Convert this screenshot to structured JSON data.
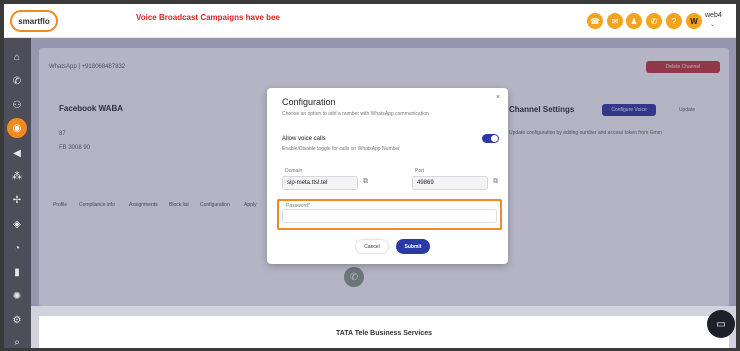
{
  "app": {
    "logo_text": "smartflo"
  },
  "banner": "Voice Broadcast Campaigns have bee",
  "user": {
    "name": "web4",
    "avatar_initial": "W"
  },
  "background": {
    "breadcrumb": "WhatsApp | +918068487832",
    "delete_button": "Delete Channel",
    "section_title": "Facebook WABA",
    "channel_settings_title": "Channel Settings",
    "channel_settings_desc": "Update configuration by adding number and access token from Gmm",
    "configure_voice_button": "Configure Voice",
    "update_button": "Update",
    "row1": "87",
    "row2": "FB 3008 90",
    "tabs": [
      "Profile",
      "Compliance info",
      "Assignments",
      "Block list",
      "Configuration",
      "Apply"
    ]
  },
  "modal": {
    "title": "Configuration",
    "subtitle": "Choose an option to add a number with WhatsApp communication",
    "close": "×",
    "voice_label": "Allow voice calls",
    "voice_sub": "Enable/Disable toggle for calls on WhatsApp Number",
    "voice_enabled": true,
    "domain_label": "Domain",
    "domain_value": "sip-meta.ttsl.tel",
    "port_label": "Port",
    "port_value": "49869",
    "password_label": "Password*",
    "password_value": "",
    "cancel": "Cancel",
    "submit": "Submit"
  },
  "footer": "TATA Tele Business Services",
  "colors": {
    "accent": "#f3a41f",
    "primary": "#2c3aa8",
    "highlight": "#f08a24",
    "banner": "#e02020"
  },
  "icons": {
    "topbar": [
      "phone-icon",
      "message-icon",
      "agent-icon",
      "call-icon",
      "help-icon"
    ],
    "sidebar": [
      "home-icon",
      "phone-icon",
      "users-icon",
      "channel-icon",
      "megaphone-icon",
      "network-icon",
      "routing-icon",
      "speaker-icon",
      "pie-chart-icon",
      "bar-chart-icon",
      "settings-icon",
      "gear-icon",
      "search-icon"
    ]
  }
}
